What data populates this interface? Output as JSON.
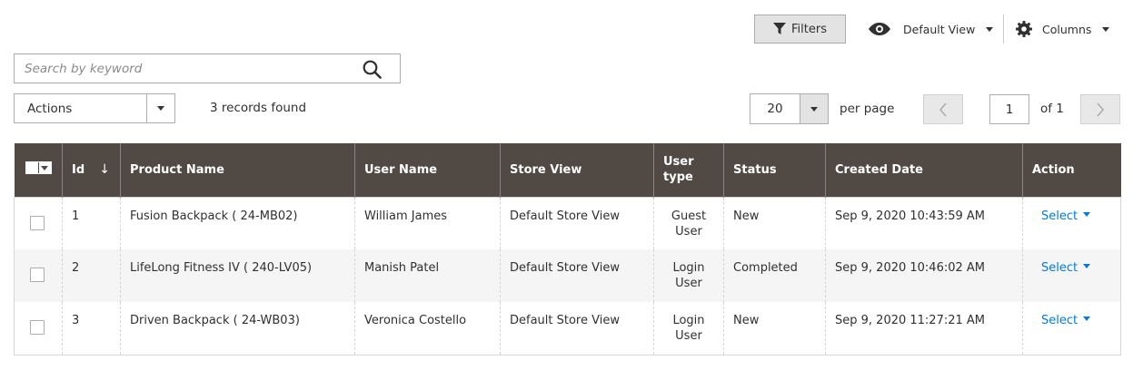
{
  "toolbar": {
    "filters_label": "Filters",
    "view_label": "Default View",
    "columns_label": "Columns"
  },
  "search": {
    "placeholder": "Search by keyword",
    "value": ""
  },
  "actions": {
    "label": "Actions"
  },
  "records_found": "3 records found",
  "pagination": {
    "per_page_value": "20",
    "per_page_label": "per page",
    "current_page": "1",
    "of_label": "of 1"
  },
  "table": {
    "headers": {
      "id": "Id",
      "product_name": "Product Name",
      "user_name": "User Name",
      "store_view": "Store View",
      "user_type": "User type",
      "status": "Status",
      "created_date": "Created Date",
      "action": "Action"
    },
    "sort_indicator": "↓",
    "rows": [
      {
        "id": "1",
        "product_name": "Fusion Backpack ( 24-MB02)",
        "user_name": "William James",
        "store_view": "Default Store View",
        "user_type": "Guest User",
        "user_type_is_link": false,
        "status": "New",
        "created_date": "Sep 9, 2020 10:43:59 AM",
        "action": "Select"
      },
      {
        "id": "2",
        "product_name": "LifeLong Fitness IV ( 240-LV05)",
        "user_name": "Manish Patel",
        "store_view": "Default Store View",
        "user_type": "Login User",
        "user_type_is_link": true,
        "status": "Completed",
        "created_date": "Sep 9, 2020 10:46:02 AM",
        "action": "Select"
      },
      {
        "id": "3",
        "product_name": "Driven Backpack ( 24-WB03)",
        "user_name": "Veronica Costello",
        "store_view": "Default Store View",
        "user_type": "Login User",
        "user_type_is_link": true,
        "status": "New",
        "created_date": "Sep 9, 2020 11:27:21 AM",
        "action": "Select"
      }
    ]
  },
  "colors": {
    "header_bg": "#514943",
    "link": "#007bdb",
    "row_alt": "#f5f5f5"
  },
  "icons": {
    "filters": "funnel-icon",
    "view": "eye-icon",
    "columns": "gear-icon",
    "search": "search-icon",
    "prev": "chevron-left-icon",
    "next": "chevron-right-icon"
  }
}
